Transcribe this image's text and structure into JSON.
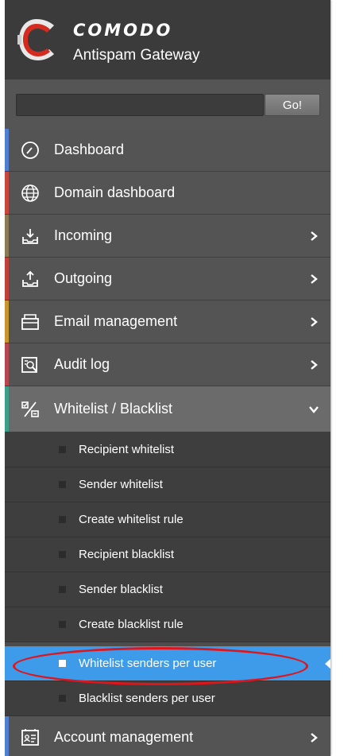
{
  "brand": {
    "name": "COMODO",
    "product": "Antispam Gateway"
  },
  "search": {
    "value": "",
    "button_label": "Go!"
  },
  "nav": {
    "items": [
      {
        "label": "Dashboard",
        "icon": "dashboard-gauge-icon",
        "accent": "#4f7fd0",
        "has_children": false
      },
      {
        "label": "Domain dashboard",
        "icon": "globe-icon",
        "accent": "#c9463c",
        "has_children": false
      },
      {
        "label": "Incoming",
        "icon": "inbox-download-icon",
        "accent": "#8a7a55",
        "has_children": true
      },
      {
        "label": "Outgoing",
        "icon": "outbox-upload-icon",
        "accent": "#c0403a",
        "has_children": true
      },
      {
        "label": "Email management",
        "icon": "envelope-icon",
        "accent": "#c8962f",
        "has_children": true
      },
      {
        "label": "Audit log",
        "icon": "audit-search-icon",
        "accent": "#b84650",
        "has_children": true
      },
      {
        "label": "Whitelist / Blacklist",
        "icon": "whitelist-blacklist-icon",
        "accent": "#3d9f8a",
        "has_children": true,
        "expanded": true
      },
      {
        "label": "Account management",
        "icon": "account-card-icon",
        "accent": "#4f7fd0",
        "has_children": true
      }
    ],
    "sub_items": [
      "Recipient whitelist",
      "Sender whitelist",
      "Create whitelist rule",
      "Recipient blacklist",
      "Sender blacklist",
      "Create blacklist rule",
      "Whitelist senders per user",
      "Blacklist senders per user"
    ],
    "active_sub_item": "Whitelist senders per user"
  },
  "colors": {
    "sidebar_bg": "#545454",
    "submenu_bg": "#3e3e3e",
    "active_bg": "#3d9be9",
    "highlight_ring": "#e0151c"
  }
}
